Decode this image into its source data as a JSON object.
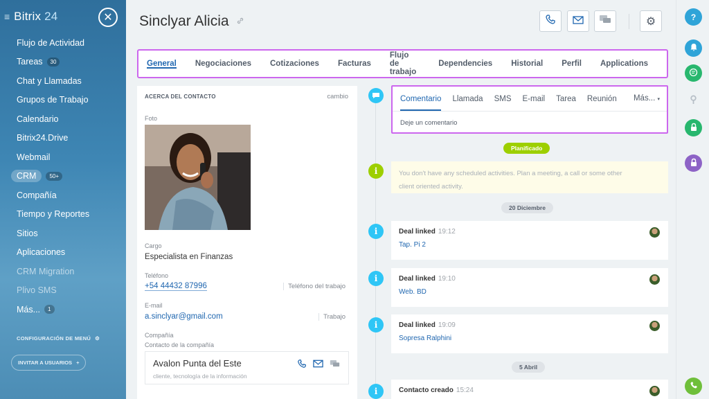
{
  "sidebar": {
    "brand": "Bitrix",
    "brand_num": "24",
    "items": [
      {
        "label": "Flujo de Actividad"
      },
      {
        "label": "Tareas",
        "badge": "30"
      },
      {
        "label": "Chat y Llamadas"
      },
      {
        "label": "Grupos de Trabajo"
      },
      {
        "label": "Calendario"
      },
      {
        "label": "Bitrix24.Drive"
      },
      {
        "label": "Webmail"
      },
      {
        "label": "CRM",
        "badge": "50+"
      },
      {
        "label": "Compañía"
      },
      {
        "label": "Tiempo y Reportes"
      },
      {
        "label": "Sitios"
      },
      {
        "label": "Aplicaciones"
      },
      {
        "label": "CRM Migration"
      },
      {
        "label": "Plivo SMS"
      },
      {
        "label": "Más...",
        "badge": "1"
      }
    ],
    "config_label": "CONFIGURACIÓN DE MENÚ",
    "invite_label": "INVITAR A USUARIOS"
  },
  "contact": {
    "name": "Sinclyar Alicia"
  },
  "tabs": [
    "General",
    "Negociaciones",
    "Cotizaciones",
    "Facturas",
    "Flujo de trabajo",
    "Dependencies",
    "Historial",
    "Perfil",
    "Applications"
  ],
  "card": {
    "heading": "ACERCA DEL CONTACTO",
    "edit": "cambio",
    "photo_label": "Foto",
    "position_label": "Cargo",
    "position": "Especialista en Finanzas",
    "phone_label": "Teléfono",
    "phone": "+54 44432 87996",
    "phone_type": "Teléfono del trabajo",
    "email_label": "E-mail",
    "email": "a.sinclyar@gmail.com",
    "email_type": "Trabajo",
    "company_label": "Compañía",
    "company_sublabel": "Contacto de la compañía",
    "company_name": "Avalon Punta del Este",
    "company_desc": "cliente, tecnología de la información"
  },
  "editor": {
    "tabs": [
      "Comentario",
      "Llamada",
      "SMS",
      "E-mail",
      "Tarea",
      "Reunión"
    ],
    "more": "Más...",
    "placeholder": "Deje un comentario"
  },
  "timeline": {
    "planned_label": "Planificado",
    "scheduled_text_1": "You don't have any scheduled activities. Plan a meeting, a call or some other",
    "scheduled_text_2": "client oriented activity.",
    "date1": "20 Diciembre",
    "date2": "5 Abril",
    "items": [
      {
        "title": "Deal linked",
        "time": "19:12",
        "link": "Tap. Pi 2"
      },
      {
        "title": "Deal linked",
        "time": "19:10",
        "link": "Web. BD"
      },
      {
        "title": "Deal linked",
        "time": "19:09",
        "link": "Sopresa Ralphini"
      },
      {
        "title": "Contacto creado",
        "time": "15:24",
        "link": ""
      }
    ]
  },
  "colors": {
    "accent": "#2067b0",
    "highlight": "#cc66ee",
    "timeline_blue": "#2fc6f6",
    "timeline_green": "#9dcf00"
  }
}
